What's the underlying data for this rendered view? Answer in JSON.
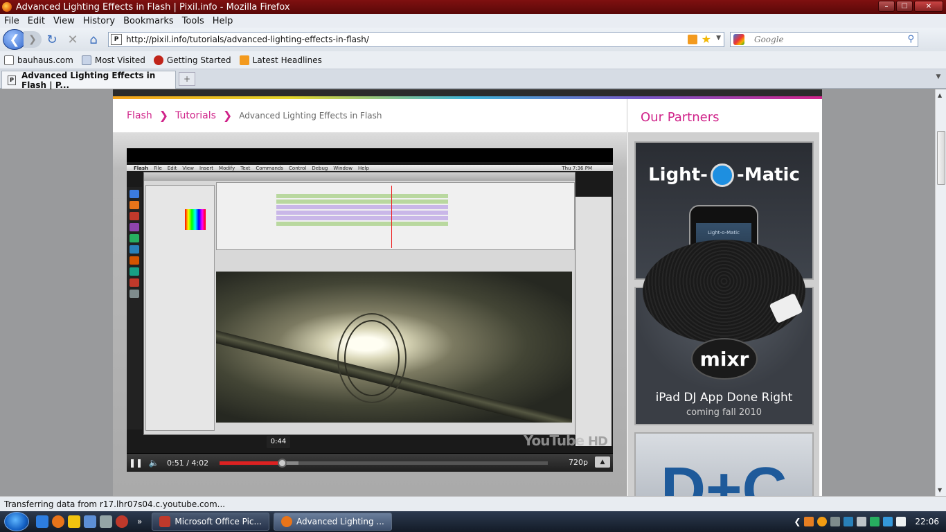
{
  "window": {
    "title": "Advanced Lighting Effects in Flash | Pixil.info - Mozilla Firefox",
    "buttons": [
      "–",
      "☐",
      "✕"
    ]
  },
  "menu": [
    "File",
    "Edit",
    "View",
    "History",
    "Bookmarks",
    "Tools",
    "Help"
  ],
  "nav": {
    "url": "http://pixil.info/tutorials/advanced-lighting-effects-in-flash/",
    "search_placeholder": "Google",
    "site_icon": "P"
  },
  "bookmarks": [
    {
      "label": "bauhaus.com",
      "icon": "rd-icon",
      "color": "#ffffff"
    },
    {
      "label": "Most Visited",
      "icon": "page-icon",
      "color": "#c8d4e8"
    },
    {
      "label": "Getting Started",
      "icon": "firefox-getting-started-icon",
      "color": "#c0241a"
    },
    {
      "label": "Latest Headlines",
      "icon": "rss-icon",
      "color": "#f39a1e"
    }
  ],
  "tab": {
    "label": "Advanced Lighting Effects in Flash | P...",
    "new_tab": "+"
  },
  "page": {
    "breadcrumb": {
      "home": "Flash",
      "section": "Tutorials",
      "current": "Advanced Lighting Effects in Flash"
    },
    "sidebar_title": "Our Partners",
    "ads": {
      "ad1": {
        "brand_left": "Light-",
        "brand_right": "-Matic",
        "app_label": "Light-o-Matic"
      },
      "ad2": {
        "logo": "mixr",
        "tagline": "iPad DJ App Done Right",
        "subline": "coming fall 2010"
      },
      "ad3": {
        "logo": "D+C"
      }
    },
    "video": {
      "mac_menu": [
        "Flash",
        "File",
        "Edit",
        "View",
        "Insert",
        "Modify",
        "Text",
        "Commands",
        "Control",
        "Debug",
        "Window",
        "Help"
      ],
      "mac_clock": "Thu 7:36 PM",
      "time": "0:51 / 4:02",
      "hover_time": "0:44",
      "quality": "720p",
      "progress_played": 0.19,
      "progress_loaded": 0.24,
      "youtube_logo": "YouTube",
      "hd_label": "HD"
    }
  },
  "status": "Transferring data from r17.lhr07s04.c.youtube.com...",
  "taskbar": {
    "tasks": [
      {
        "label": "Microsoft Office Pic...",
        "color": "#c0392b"
      },
      {
        "label": "Advanced Lighting ...",
        "color": "#e8741a"
      }
    ],
    "clock": "22:06"
  }
}
